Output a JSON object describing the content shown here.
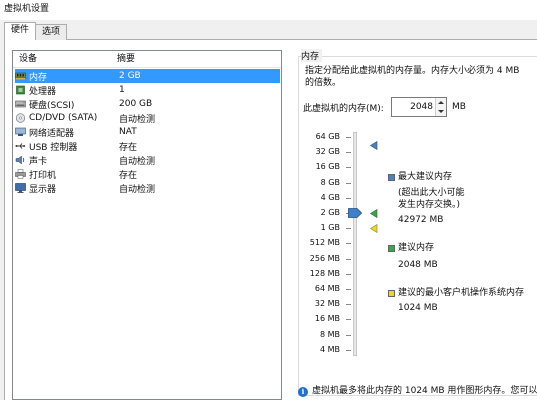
{
  "window": {
    "title": "虚拟机设置"
  },
  "tabs": [
    {
      "label": "硬件",
      "active": true
    },
    {
      "label": "选项",
      "active": false
    }
  ],
  "device_list": {
    "headers": {
      "device": "设备",
      "summary": "摘要"
    },
    "rows": [
      {
        "icon": "memory-icon",
        "device": "内存",
        "summary": "2 GB",
        "selected": true
      },
      {
        "icon": "processor-icon",
        "device": "处理器",
        "summary": "1",
        "selected": false
      },
      {
        "icon": "hard-disk-icon",
        "device": "硬盘(SCSI)",
        "summary": "200 GB",
        "selected": false
      },
      {
        "icon": "cd-dvd-icon",
        "device": "CD/DVD (SATA)",
        "summary": "自动检测",
        "selected": false
      },
      {
        "icon": "network-adapter-icon",
        "device": "网络适配器",
        "summary": "NAT",
        "selected": false
      },
      {
        "icon": "usb-icon",
        "device": "USB 控制器",
        "summary": "存在",
        "selected": false
      },
      {
        "icon": "sound-card-icon",
        "device": "声卡",
        "summary": "自动检测",
        "selected": false
      },
      {
        "icon": "printer-icon",
        "device": "打印机",
        "summary": "存在",
        "selected": false
      },
      {
        "icon": "display-icon",
        "device": "显示器",
        "summary": "自动检测",
        "selected": false
      }
    ]
  },
  "memory": {
    "section_title": "内存",
    "description_line1": "指定分配给此虚拟机的内存量。内存大小必须为 4 MB",
    "description_line2": "的倍数。",
    "field_label": "此虚拟机的内存(M):",
    "value": "2048",
    "unit": "MB",
    "scale_labels": [
      "64 GB",
      "32 GB",
      "16 GB",
      "8 GB",
      "4 GB",
      "2 GB",
      "1 GB",
      "512 MB",
      "256 MB",
      "128 MB",
      "64 MB",
      "32 MB",
      "16 MB",
      "8 MB",
      "4 MB"
    ],
    "legend": {
      "max_recommended": {
        "label": "最大建议内存",
        "note_line1": "(超出此大小可能",
        "note_line2": "发生内存交换。)",
        "value": "42972 MB",
        "color": "#4a7fc1"
      },
      "recommended": {
        "label": "建议内存",
        "value": "2048 MB",
        "color": "#3aa64a"
      },
      "guest_min": {
        "label": "建议的最小客户机操作系统内存",
        "value": "1024 MB",
        "color": "#e8d82a"
      }
    },
    "info_text": "虚拟机最多将此内存的 1024 MB 用作图形内存。您可以"
  }
}
